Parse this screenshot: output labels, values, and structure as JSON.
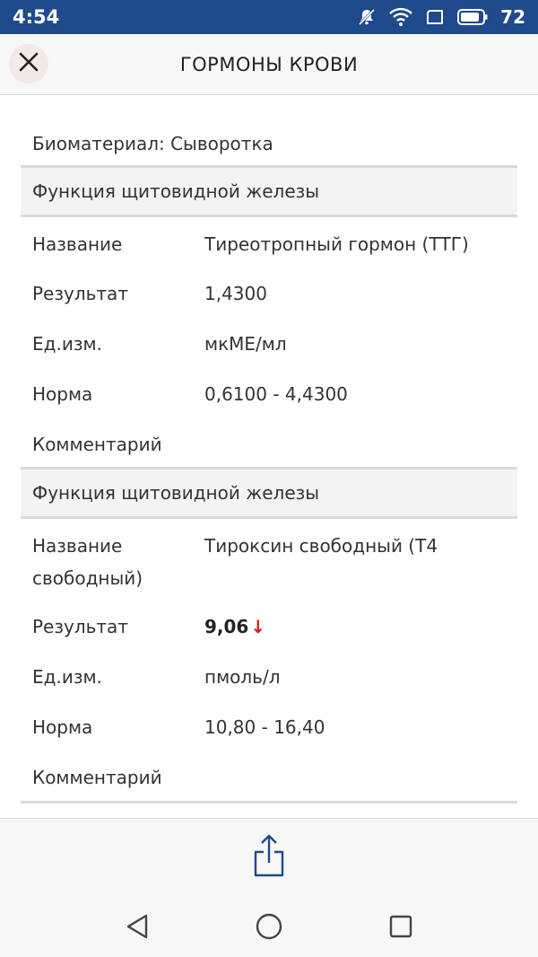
{
  "status_bar": {
    "time": "4:54",
    "battery": "72"
  },
  "header": {
    "title": "ГОРМОНЫ КРОВИ"
  },
  "biomaterial": "Биоматериал: Сыворотка",
  "sections": [
    {
      "title": "Функция щитовидной железы",
      "name_label": "Название",
      "name_value": "Тиреотропный гормон (ТТГ)",
      "result_label": "Результат",
      "result_value": "1,4300",
      "unit_label": "Ед.изм.",
      "unit_value": "мкМЕ/мл",
      "norm_label": "Норма",
      "norm_value": "0,6100 - 4,4300",
      "comment_label": "Комментарий"
    },
    {
      "title": "Функция щитовидной железы",
      "name_label": "Название",
      "name_value_line1": "Тироксин свободный (Т4",
      "name_value_line2": "свободный)",
      "result_label": "Результат",
      "result_value": "9,06",
      "result_flag": "↓",
      "unit_label": "Ед.изм.",
      "unit_value": "пмоль/л",
      "norm_label": "Норма",
      "norm_value": "10,80 - 16,40",
      "comment_label": "Комментарий"
    }
  ],
  "colors": {
    "status_bar": "#1f4a8c",
    "accent_icon": "#1f4a8c",
    "flag_low": "#d61d1d"
  },
  "icons": {
    "close": "close-icon",
    "share": "share-icon",
    "nav_back": "back-triangle-icon",
    "nav_home": "home-circle-icon",
    "nav_recents": "recents-square-icon"
  }
}
